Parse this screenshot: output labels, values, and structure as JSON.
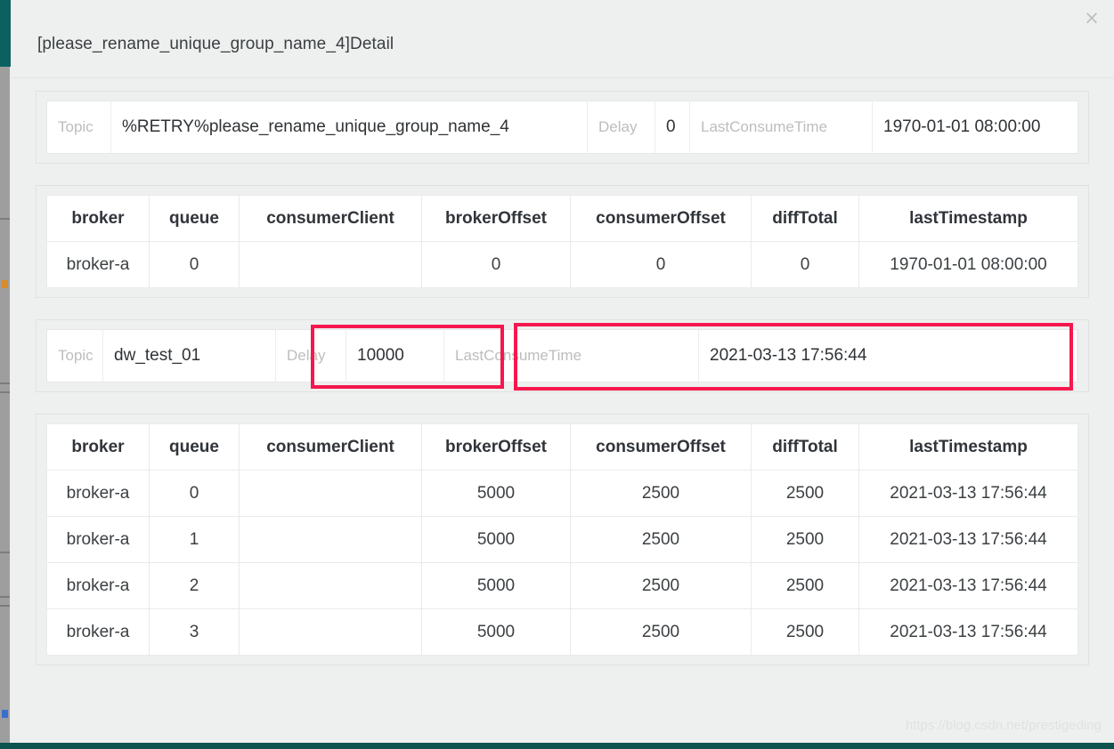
{
  "modal": {
    "title": "[please_rename_unique_group_name_4]Detail",
    "close_icon": "close-icon",
    "close_glyph": "×"
  },
  "accent": {
    "highlight_red": "#f5174e",
    "app_teal": "#0c6160",
    "muted_label": "#bdbdbd"
  },
  "blocks": [
    {
      "summary": {
        "topic_label": "Topic",
        "topic_value": "%RETRY%please_rename_unique_group_name_4",
        "delay_label": "Delay",
        "delay_value": "0",
        "last_consume_time_label": "LastConsumeTime",
        "last_consume_time_value": "1970-01-01 08:00:00"
      },
      "table": {
        "headers": [
          "broker",
          "queue",
          "consumerClient",
          "brokerOffset",
          "consumerOffset",
          "diffTotal",
          "lastTimestamp"
        ],
        "rows": [
          [
            "broker-a",
            "0",
            "",
            "0",
            "0",
            "0",
            "1970-01-01 08:00:00"
          ]
        ]
      }
    },
    {
      "summary": {
        "topic_label": "Topic",
        "topic_value": "dw_test_01",
        "delay_label": "Delay",
        "delay_value": "10000",
        "last_consume_time_label": "LastConsumeTime",
        "last_consume_time_value": "2021-03-13 17:56:44"
      },
      "table": {
        "headers": [
          "broker",
          "queue",
          "consumerClient",
          "brokerOffset",
          "consumerOffset",
          "diffTotal",
          "lastTimestamp"
        ],
        "rows": [
          [
            "broker-a",
            "0",
            "",
            "5000",
            "2500",
            "2500",
            "2021-03-13 17:56:44"
          ],
          [
            "broker-a",
            "1",
            "",
            "5000",
            "2500",
            "2500",
            "2021-03-13 17:56:44"
          ],
          [
            "broker-a",
            "2",
            "",
            "5000",
            "2500",
            "2500",
            "2021-03-13 17:56:44"
          ],
          [
            "broker-a",
            "3",
            "",
            "5000",
            "2500",
            "2500",
            "2021-03-13 17:56:44"
          ]
        ]
      }
    }
  ],
  "watermark": "https://blog.csdn.net/prestigeding"
}
